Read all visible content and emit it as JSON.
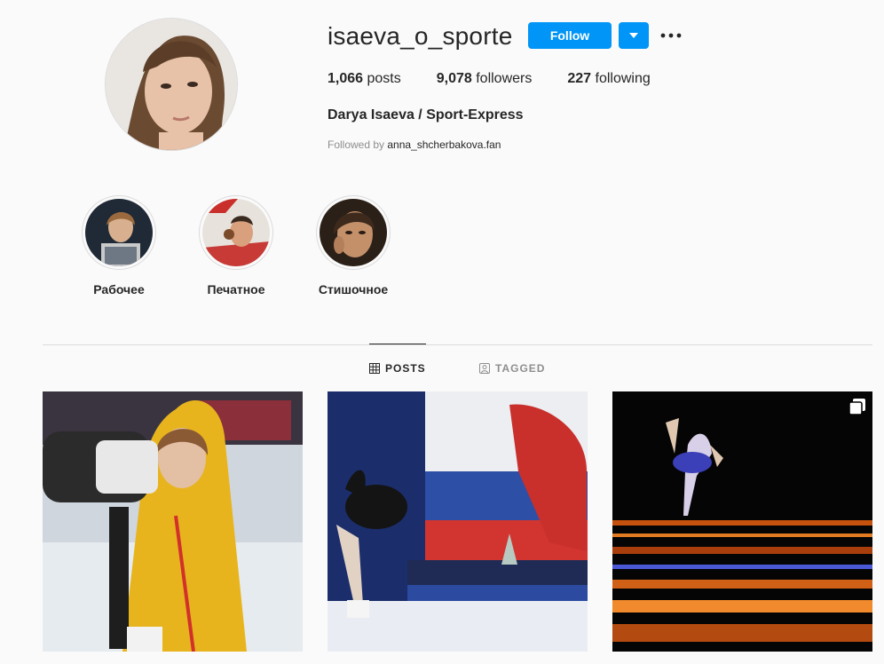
{
  "profile": {
    "username": "isaeva_o_sporte",
    "follow_label": "Follow",
    "posts_count": "1,066",
    "posts_label": " posts",
    "followers_count": "9,078",
    "followers_label": " followers",
    "following_count": "227",
    "following_label": " following",
    "full_name": "Darya Isaeva / Sport-Express",
    "followed_by_prefix": "Followed by ",
    "followed_by_account": "anna_shcherbakova.fan"
  },
  "highlights": [
    {
      "label": "Рабочее"
    },
    {
      "label": "Печатное"
    },
    {
      "label": "Стишочное"
    }
  ],
  "tabs": [
    {
      "label": "POSTS",
      "icon": "grid-icon",
      "active": true
    },
    {
      "label": "TAGGED",
      "icon": "tagged-icon",
      "active": false
    }
  ],
  "posts": [
    {
      "description": "photo",
      "multi": false
    },
    {
      "description": "photo",
      "multi": false
    },
    {
      "description": "photo",
      "multi": true
    }
  ],
  "colors": {
    "accent": "#0095f6",
    "text": "#262626",
    "muted": "#8e8e8e",
    "border": "#dbdbdb",
    "background": "#fafafa"
  }
}
